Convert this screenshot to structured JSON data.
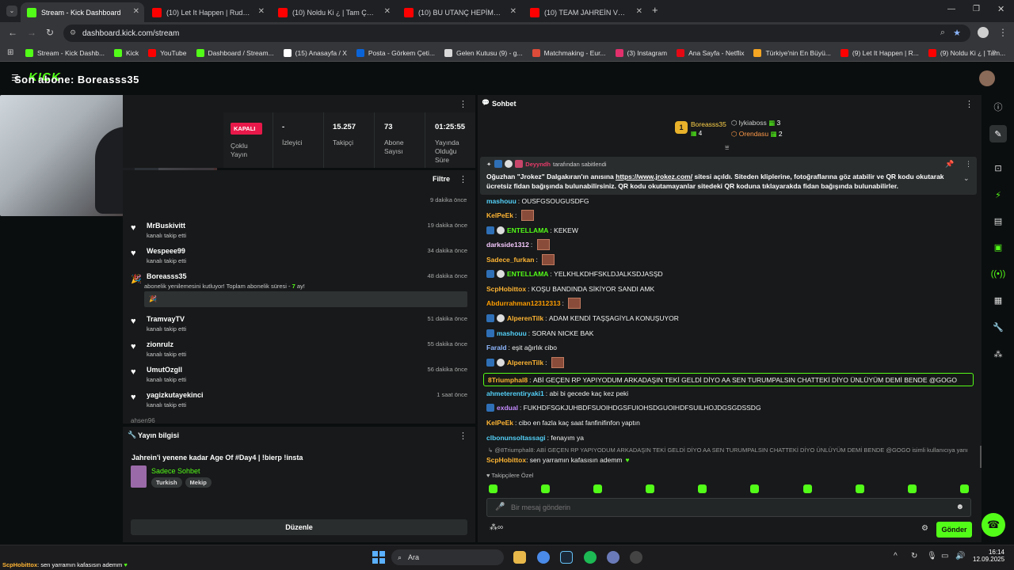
{
  "browser": {
    "tabs": [
      {
        "title": "Stream - Kick Dashboard",
        "fav": "#53fc18",
        "active": true
      },
      {
        "title": "(10) Let It Happen | Ruddy - Yo",
        "fav": "#ff0000"
      },
      {
        "title": "(10) Noldu Ki ¿ | Tam Çerezlik",
        "fav": "#ff0000"
      },
      {
        "title": "(10) BU UTANÇ HEPİMİZİN | M",
        "fav": "#ff0000"
      },
      {
        "title": "(10) TEAM JAHREİN VS TEAM",
        "fav": "#ff0000"
      }
    ],
    "url": "dashboard.kick.com/stream",
    "bookmarks": [
      {
        "label": "Stream - Kick Dashb...",
        "color": "#53fc18"
      },
      {
        "label": "Kick",
        "color": "#53fc18"
      },
      {
        "label": "YouTube",
        "color": "#ff0000"
      },
      {
        "label": "Dashboard / Stream...",
        "color": "#53fc18"
      },
      {
        "label": "(15) Anasayfa / X",
        "color": "#ffffff"
      },
      {
        "label": "Posta - Görkem Çeti...",
        "color": "#0a64d8"
      },
      {
        "label": "Gelen Kutusu (9) - g...",
        "color": "#d9d9d9"
      },
      {
        "label": "Matchmaking - Eur...",
        "color": "#dd4b39"
      },
      {
        "label": "(3) Instagram",
        "color": "#e1306c"
      },
      {
        "label": "Ana Sayfa - Netflix",
        "color": "#e50914"
      },
      {
        "label": "Türkiye'nin En Büyü...",
        "color": "#f5a623"
      },
      {
        "label": "(9) Let It Happen | R...",
        "color": "#ff0000"
      },
      {
        "label": "(9) Noldu Ki ¿ | Tam...",
        "color": "#ff0000"
      }
    ]
  },
  "overlay": {
    "text": "Son abone: Boreasss35"
  },
  "stats": [
    {
      "value": "KAPALI",
      "label": "Çoklu Yayın"
    },
    {
      "value": "-",
      "label": "İzleyici"
    },
    {
      "value": "15.257",
      "label": "Takipçi"
    },
    {
      "value": "73",
      "label": "Abone Sayısı"
    },
    {
      "value": "01:25:55",
      "label": "Yayında Olduğu Süre"
    }
  ],
  "activity": {
    "filter_label": "Filtre",
    "first_time": "9 dakika önce",
    "items": [
      {
        "name": "MrBuskivitt",
        "sub": "kanalı takip etti",
        "time": "19 dakika önce"
      },
      {
        "name": "Wespeee99",
        "sub": "kanalı takip etti",
        "time": "34 dakika önce"
      },
      {
        "name": "Boreasss35",
        "sub": "abonelik yenilemesini kutluyor! Toplam abonelik süresi - ",
        "months": "7",
        "unit": " ay!",
        "time": "48 dakika önce"
      },
      {
        "name": "TramvayTV",
        "sub": "kanalı takip etti",
        "time": "51 dakika önce"
      },
      {
        "name": "zionrulz",
        "sub": "kanalı takip etti",
        "time": "55 dakika önce"
      },
      {
        "name": "UmutOzgll",
        "sub": "kanalı takip etti",
        "time": "56 dakika önce"
      },
      {
        "name": "yagizkutayekinci",
        "sub": "kanalı takip etti",
        "time": "1 saat önce"
      }
    ]
  },
  "stream_info": {
    "header": "Yayın bilgisi",
    "title": "Jahrein'i yenene kadar Age Of #Day4 | !bierp !insta",
    "category": "Sadece Sohbet",
    "tags": [
      "Turkish",
      "Mekip"
    ],
    "edit_label": "Düzenle"
  },
  "chat": {
    "header": "Sohbet",
    "leaders": [
      {
        "rank": "1",
        "name": "Boreasss35",
        "count": "4"
      },
      {
        "name": "lykiaboss",
        "count": "3"
      },
      {
        "name": "Orendasu",
        "count": "2"
      }
    ],
    "pinned_by": "Deyyndh",
    "pinned_suffix": "tarafından sabitlendi",
    "pinned_pre": "Oğuzhan \"Jrokez\" Dalgakıran'ın anısına ",
    "pinned_link": "https://www.jrokez.com/",
    "pinned_post": " sitesi açıldı. Siteden kliplerine, fotoğraflarına göz atabilir ve QR kodu okutarak ücretsiz fidan bağışında bulunabilirsiniz. QR kodu okutamayanlar sitedeki QR koduna tıklayarakda fidan bağışında bulunabilirler.",
    "messages": [
      {
        "user": "mashouu",
        "color": "#54d0f8",
        "text": "OUSFGSOUGUSDFG",
        "badges": 0
      },
      {
        "user": "KelPeEk",
        "color": "#ffb534",
        "text": "",
        "emote": true,
        "badges": 0
      },
      {
        "user": "ENTELLAMA",
        "color": "#53fc18",
        "text": "KEKEW",
        "badges": 2
      },
      {
        "user": "darkside1312",
        "color": "#f6c9ff",
        "text": "",
        "emote": true,
        "badges": 0
      },
      {
        "user": "Sadece_furkan",
        "color": "#ffb534",
        "text": "",
        "emote": true,
        "badges": 0
      },
      {
        "user": "ENTELLAMA",
        "color": "#53fc18",
        "text": "YELKHLKDHFSKLDJALKSDJASŞD",
        "badges": 2
      },
      {
        "user": "ScpHobittox",
        "color": "#ffb534",
        "text": "KOŞU BANDINDA SİKİYOR SANDI AMK",
        "badges": 0
      },
      {
        "user": "Abdurrahman12312313",
        "color": "#ff9d00",
        "text": "",
        "emote": true,
        "badges": 0
      },
      {
        "user": "AlperenTilk",
        "color": "#ffb534",
        "text": "ADAM KENDİ TAŞŞAGİYLA KONUŞUYOR",
        "badges": 2
      },
      {
        "user": "mashouu",
        "color": "#54d0f8",
        "text": "SORAN NICKE BAK",
        "badges": 1
      },
      {
        "user": "Farald",
        "color": "#8fb8ff",
        "text": "eşit ağırlık cibo",
        "badges": 0
      },
      {
        "user": "AlperenTilk",
        "color": "#ffb534",
        "text": "",
        "emote": true,
        "badges": 2
      },
      {
        "user": "8Triumphal8",
        "color": "#ffb534",
        "text": "ABİ GEÇEN RP YAPIYODUM ARKADAŞIN TEKİ GELDİ DİYO AA SEN TURUMPALSIN CHATTEKİ DİYO ÜNLÜYÜM DEMİ BENDE @GOGO",
        "badges": 0,
        "highlight": true
      },
      {
        "user": "ahmeterentiryaki1",
        "color": "#54d0f8",
        "text": "abi bi gecede kaç kez peki",
        "badges": 0
      },
      {
        "user": "exdual",
        "color": "#c58bff",
        "text": "FUKHDFSGKJUHBDFSUOIHDGSFUIOHSDGUOIHDFSUILHOJDGSGDSSDG",
        "badges": 1
      },
      {
        "user": "KelPeEk",
        "color": "#ffb534",
        "text": "cibo en fazla kaç saat fanfinifinfon yaptın",
        "badges": 0
      },
      {
        "user": "clbonunsoltassagi",
        "color": "#54d0f8",
        "text": "fenayım ya",
        "badges": 0
      }
    ],
    "reply_ref": "@8Triumphal8: ABİ GEÇEN RP YAPIYODUM ARKADAŞIN TEKİ GELDİ DİYO AA SEN TURUMPALSIN CHATTEKİ DİYO ÜNLÜYÜM DEMİ BENDE @GOGO isimli kullanıcıya yanıt veri...",
    "reply_user": "ScpHobittox",
    "reply_text": "sen yarramın kafasısın ademm",
    "followers_only": "Takipçilere Özel",
    "placeholder": "Bir mesaj gönderin",
    "send_label": "Gönder"
  },
  "taskbar": {
    "notification_user": "ScpHobittox",
    "notification_text": "sen yarramın kafasısın ademm",
    "search_label": "Ara",
    "time": "16:14",
    "date": "12.09.2025"
  },
  "accent": "#53fc18"
}
